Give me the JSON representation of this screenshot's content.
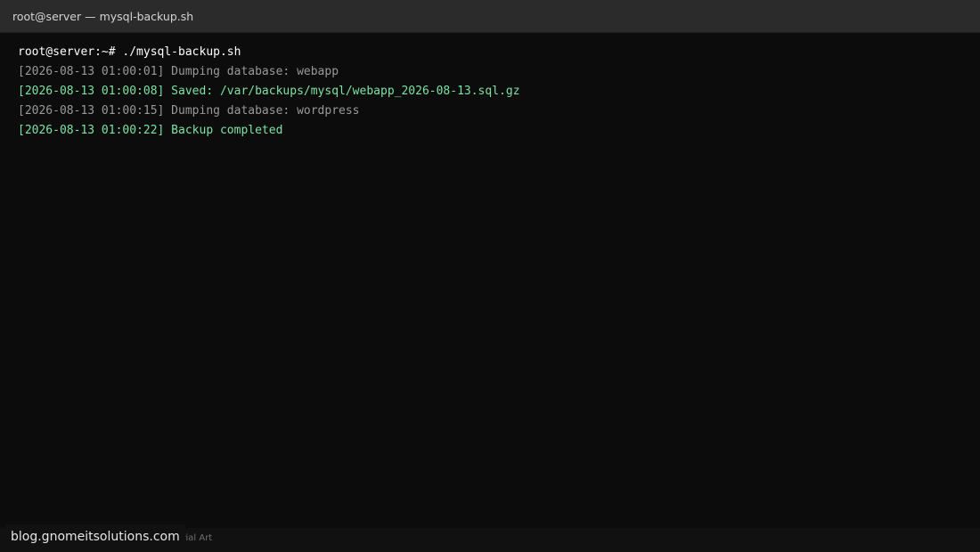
{
  "window": {
    "title": "root@server — mysql-backup.sh"
  },
  "terminal": {
    "lines": [
      {
        "text": "root@server:~# ./mysql-backup.sh",
        "style": "prompt"
      },
      {
        "text": "[2026-08-13 01:00:01] Dumping database: webapp",
        "style": "normal"
      },
      {
        "text": "[2026-08-13 01:00:08] Saved: /var/backups/mysql/webapp_2026-08-13.sql.gz",
        "style": "success"
      },
      {
        "text": "[2026-08-13 01:00:15] Dumping database: wordpress",
        "style": "normal"
      },
      {
        "text": "[2026-08-13 01:00:22] Backup completed",
        "style": "success"
      }
    ]
  },
  "footer": {
    "caption": "utorial Art",
    "watermark": "blog.gnomeitsolutions.com"
  },
  "colors": {
    "background": "#0c0c0c",
    "titlebar": "#2b2b2b",
    "prompt_text": "#ffffff",
    "log_text": "#9a9a9a",
    "success_text": "#7ee3a5"
  }
}
